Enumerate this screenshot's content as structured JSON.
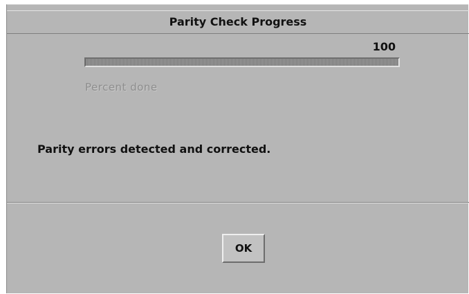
{
  "dialog": {
    "title": "Parity Check Progress"
  },
  "progress": {
    "value_text": "100",
    "percent": 100,
    "caption": "Percent done"
  },
  "status": {
    "message": "Parity errors detected and corrected."
  },
  "buttons": {
    "ok_label": "OK"
  }
}
